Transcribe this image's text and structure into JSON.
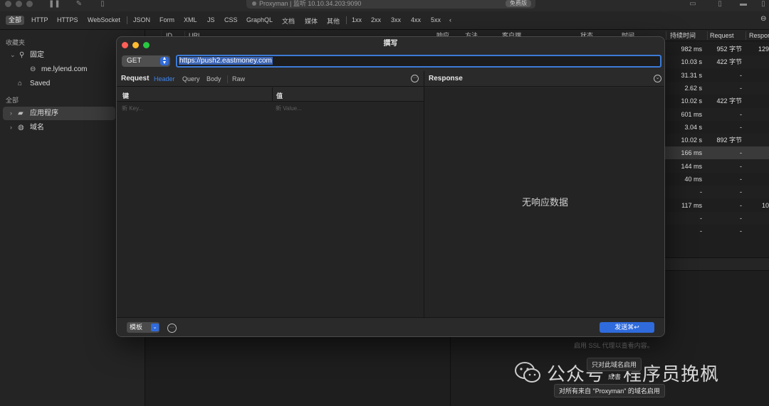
{
  "window": {
    "title_text": "Proxyman | 监听 10.10.34.203:9090",
    "edition_badge": "免费版"
  },
  "filters": [
    "全部",
    "HTTP",
    "HTTPS",
    "WebSocket",
    "JSON",
    "Form",
    "XML",
    "JS",
    "CSS",
    "GraphQL",
    "文档",
    "媒体",
    "其他",
    "1xx",
    "2xx",
    "3xx",
    "4xx",
    "5xx"
  ],
  "sidebar": {
    "favorites_label": "收藏夹",
    "pinned_label": "固定",
    "pinned_domain": "me.lylend.com",
    "saved_label": "Saved",
    "all_label": "全部",
    "apps_label": "应用程序",
    "domains_label": "域名"
  },
  "table": {
    "headers": {
      "id": "ID",
      "url": "URL",
      "code": "响应",
      "method": "方法",
      "client": "客户端",
      "status": "状态",
      "time": "时间",
      "duration": "持续时间",
      "request": "Request",
      "response": "Respor"
    },
    "rows": [
      {
        "duration": "982 ms",
        "request": "952 字节",
        "response": "129"
      },
      {
        "duration": "10.03 s",
        "request": "422 字节",
        "response": ""
      },
      {
        "duration": "31.31 s",
        "request": "-",
        "response": ""
      },
      {
        "duration": "2.62 s",
        "request": "-",
        "response": ""
      },
      {
        "duration": "10.02 s",
        "request": "422 字节",
        "response": ""
      },
      {
        "duration": "601 ms",
        "request": "-",
        "response": ""
      },
      {
        "duration": "3.04 s",
        "request": "-",
        "response": ""
      },
      {
        "duration": "10.02 s",
        "request": "892 字节",
        "response": ""
      },
      {
        "duration": "166 ms",
        "request": "-",
        "response": ""
      },
      {
        "duration": "144 ms",
        "request": "-",
        "response": ""
      },
      {
        "duration": "40 ms",
        "request": "-",
        "response": ""
      },
      {
        "duration": "-",
        "request": "-",
        "response": ""
      },
      {
        "duration": "117 ms",
        "request": "-",
        "response": "10"
      },
      {
        "duration": "-",
        "request": "-",
        "response": ""
      },
      {
        "duration": "-",
        "request": "-",
        "response": ""
      }
    ],
    "ssl_hint": "启用 SSL 代理以查看内容。"
  },
  "dialog": {
    "title": "撰写",
    "method": "GET",
    "url": "https://push2.eastmoney.com",
    "request_label": "Request",
    "tabs": [
      "Header",
      "Query",
      "Body",
      "Raw"
    ],
    "active_tab": "Header",
    "key_col": "键",
    "value_col": "值",
    "key_placeholder": "新 Key...",
    "value_placeholder": "新 Value...",
    "response_label": "Response",
    "empty_response": "无响应数据",
    "template_label": "模板",
    "send_label": "发送⌘↩"
  },
  "popups": {
    "domain_only": "只对此域名启用",
    "partial": "成書",
    "all_from_app": "对所有来自 \"Proxyman\" 的域名启用"
  },
  "watermark": "公众号 · 程序员挽枫",
  "colors": {
    "accent": "#2f6bdc",
    "link_blue": "#3d86f0",
    "close": "#fe5f57",
    "minimize": "#febc2e",
    "zoom": "#28c840"
  }
}
